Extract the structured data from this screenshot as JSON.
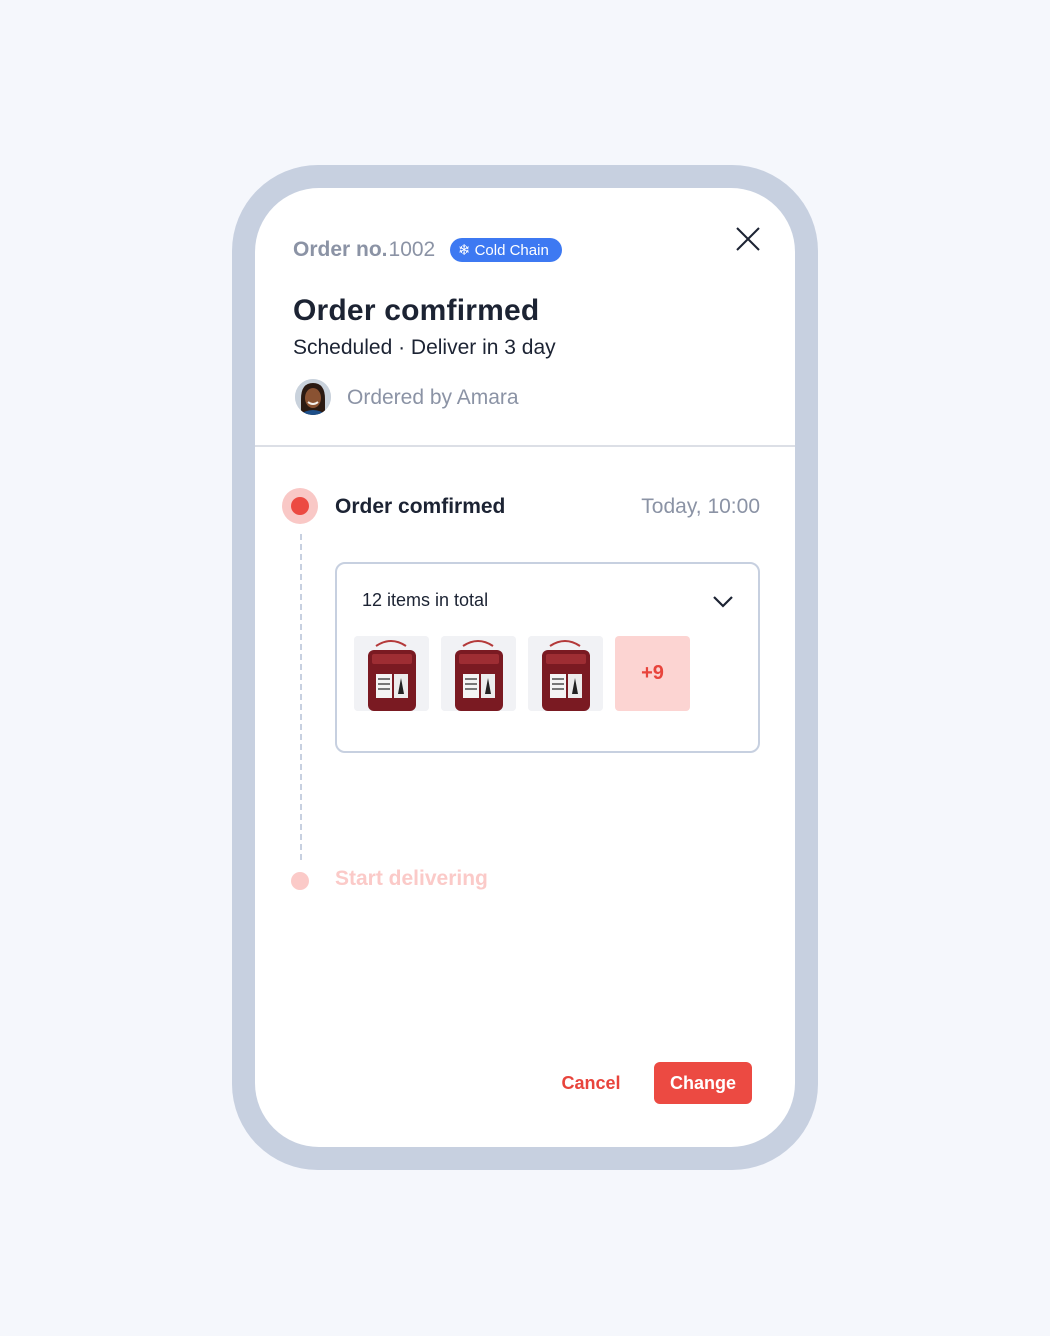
{
  "header": {
    "order_label": "Order no.",
    "order_number": "1002",
    "badge_label": "Cold Chain",
    "badge_icon": "snowflake-icon",
    "close_icon": "close-icon",
    "title": "Order comfirmed",
    "subtitle": "Scheduled · Deliver in 3 day",
    "ordered_by": "Ordered by Amara"
  },
  "timeline": {
    "steps": [
      {
        "label": "Order comfirmed",
        "time": "Today, 10:00",
        "status": "active"
      },
      {
        "label": "Start delivering",
        "status": "pending"
      }
    ]
  },
  "items": {
    "total_label": "12 items in total",
    "thumbnails": [
      "blood-bag-image",
      "blood-bag-image",
      "blood-bag-image"
    ],
    "more_label": "+9"
  },
  "actions": {
    "cancel_label": "Cancel",
    "change_label": "Change"
  },
  "colors": {
    "accent": "#ec4a42",
    "badge": "#3d79f2",
    "frame": "#c7d0e0",
    "muted_text": "#8b93a5",
    "primary_text": "#1c2333"
  }
}
